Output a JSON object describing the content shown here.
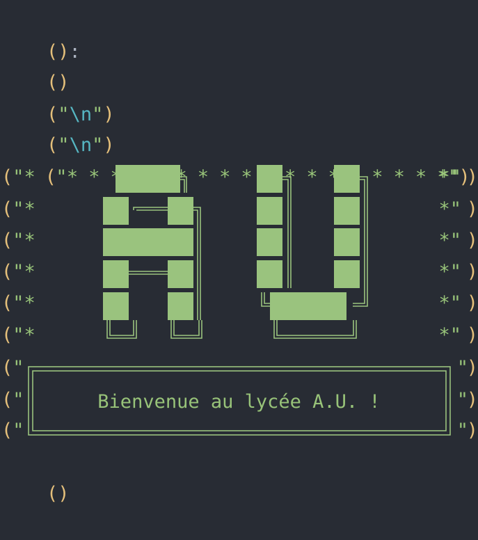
{
  "colors": {
    "background": "#282c34",
    "paren": "#e5c07b",
    "punct": "#abb2bf",
    "string": "#98c379",
    "escape": "#56b6c2",
    "block_fill": "#9ac37e"
  },
  "code": {
    "line1": {
      "paren": "()",
      "colon": ":"
    },
    "line2": {
      "paren": "()"
    },
    "line3": {
      "open": "(",
      "quote": "\"",
      "escape": "\\n",
      "close": ")"
    },
    "line4": {
      "open": "(",
      "quote": "\"",
      "escape": "\\n",
      "close": ")"
    },
    "border_top": "\"* * * * * * * * * * * * * * * * * *\"",
    "row_prefix": "\"*",
    "row_suffix": "*\"",
    "box_prefix": "\"",
    "box_suffix": "\")",
    "open_paren": "(",
    "close_paren": ")",
    "last_line": "()"
  },
  "banner": {
    "letters": "AU",
    "message": "Bienvenue au lycée A.U. !"
  }
}
